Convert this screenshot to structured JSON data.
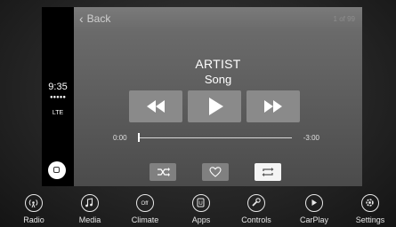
{
  "carplay_sidebar": {
    "time": "9:35",
    "signal": "●●●●●",
    "network": "LTE"
  },
  "now_playing": {
    "back_label": "Back",
    "track_count": "1 of 99",
    "artist": "ARTIST",
    "song": "Song",
    "elapsed": "0:00",
    "remaining": "-3:00",
    "progress": 0.0
  },
  "nav": {
    "items": [
      {
        "label": "Radio",
        "icon": "radio-icon"
      },
      {
        "label": "Media",
        "icon": "music-note-icon"
      },
      {
        "label": "Climate",
        "icon": "climate-off-icon"
      },
      {
        "label": "Apps",
        "icon": "apps-icon"
      },
      {
        "label": "Controls",
        "icon": "wrench-icon"
      },
      {
        "label": "CarPlay",
        "icon": "carplay-icon"
      },
      {
        "label": "Settings",
        "icon": "gear-icon"
      }
    ],
    "climate_icon_text": "Off",
    "apps_icon_text": "U"
  },
  "colors": {
    "button_bg": "#8a8a8a",
    "repeat_active": "#f4f4f4",
    "text": "#ffffff"
  }
}
